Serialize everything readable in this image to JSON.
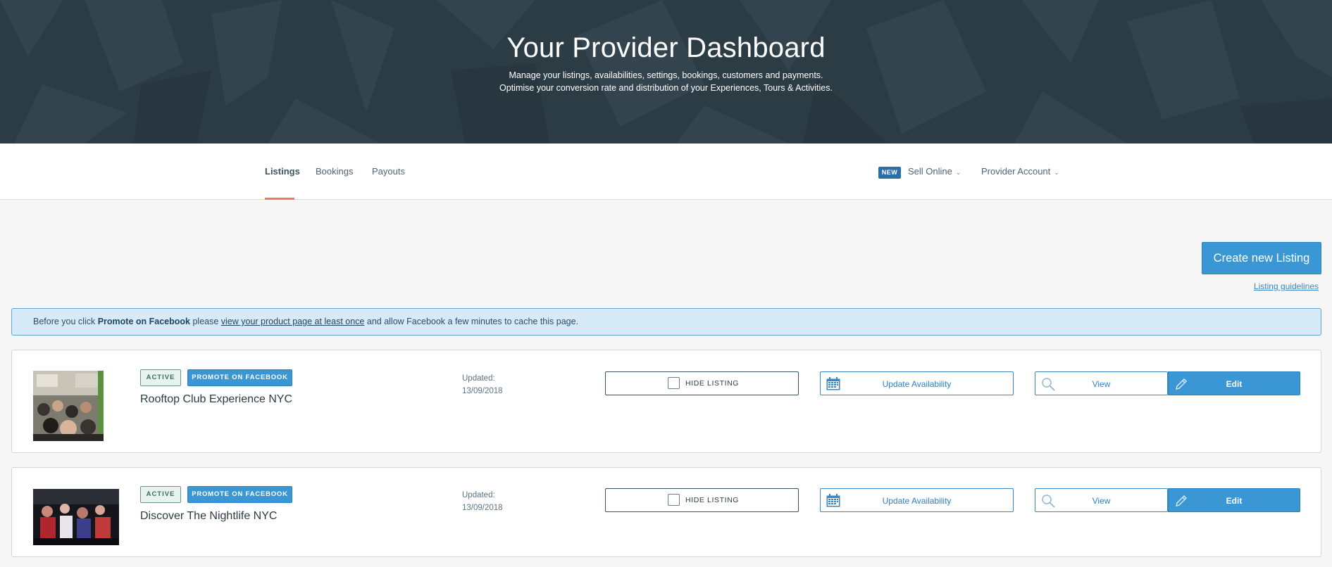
{
  "hero": {
    "title": "Your Provider Dashboard",
    "subtitle_line1": "Manage your listings, availabilities, settings, bookings, customers and payments.",
    "subtitle_line2": "Optimise your conversion rate and distribution of your Experiences, Tours & Activities.",
    "bg_color": "#2c3c45"
  },
  "nav": {
    "tabs": [
      {
        "label": "Listings",
        "active": true
      },
      {
        "label": "Bookings",
        "active": false
      },
      {
        "label": "Payouts",
        "active": false
      }
    ],
    "new_badge": "NEW",
    "sell_online": "Sell Online",
    "provider_account": "Provider Account",
    "caret_icon": "chevron-down-icon",
    "active_underline_color": "#f0795a"
  },
  "actions": {
    "create_listing": "Create new Listing",
    "guidelines": "Listing guidelines"
  },
  "banner": {
    "prefix": "Before you click ",
    "bold": "Promote on Facebook",
    "middle": " please ",
    "link": "view your product page at least once",
    "suffix": " and allow Facebook a few minutes to cache this page."
  },
  "listings": [
    {
      "title": "Rooftop Club Experience NYC",
      "status": "ACTIVE",
      "promote": "PROMOTE ON FACEBOOK",
      "updated_label": "Updated:",
      "updated_date": "13/09/2018",
      "hide_label": "HIDE LISTING",
      "availability_label": "Update Availability",
      "view_label": "View",
      "edit_label": "Edit"
    },
    {
      "title": "Discover The Nightlife NYC",
      "status": "ACTIVE",
      "promote": "PROMOTE ON FACEBOOK",
      "updated_label": "Updated:",
      "updated_date": "13/09/2018",
      "hide_label": "HIDE LISTING",
      "availability_label": "Update Availability",
      "view_label": "View",
      "edit_label": "Edit"
    }
  ],
  "colors": {
    "primary": "#3a97d4",
    "banner_bg": "#d7eaf7",
    "page_bg": "#f6f6f6"
  }
}
